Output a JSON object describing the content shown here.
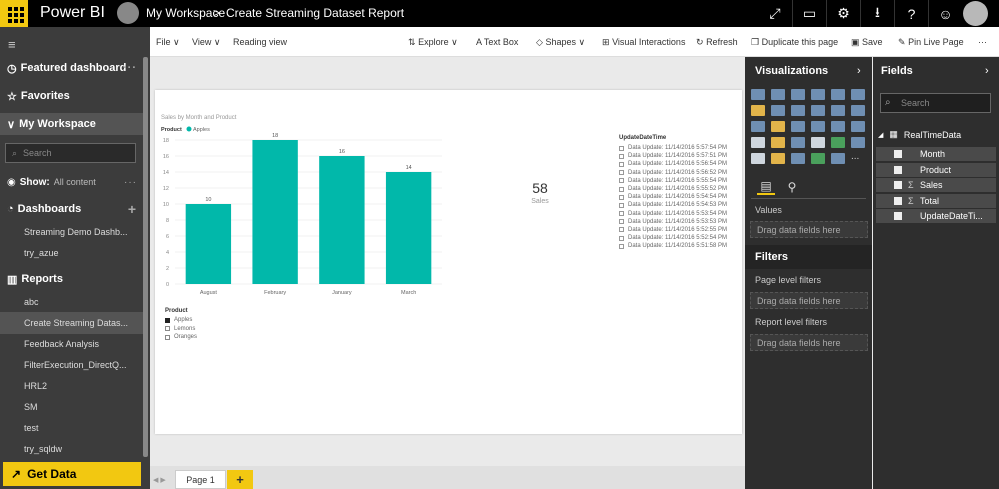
{
  "topbar": {
    "brand": "Power BI",
    "workspace": "My Workspace",
    "separator": ">",
    "report_title": "Create Streaming Dataset Report"
  },
  "sidebar": {
    "featured": "Featured dashboard",
    "favorites": "Favorites",
    "my_workspace": "My Workspace",
    "search_placeholder": "Search",
    "show_label": "Show:",
    "show_value": "All content",
    "dashboards": "Dashboards",
    "dashboard_items": [
      "Streaming Demo Dashb...",
      "try_azue"
    ],
    "reports": "Reports",
    "report_items": [
      "abc",
      "Create Streaming Datas...",
      "Feedback Analysis",
      "FilterExecution_DirectQ...",
      "HRL2",
      "SM",
      "test",
      "try_sqldw"
    ],
    "get_data": "Get Data"
  },
  "toolbar": {
    "file": "File",
    "view": "View",
    "reading_view": "Reading view",
    "explore": "Explore",
    "text_box": "Text Box",
    "shapes": "Shapes",
    "visual_interactions": "Visual Interactions",
    "refresh": "Refresh",
    "duplicate": "Duplicate this page",
    "save": "Save",
    "pin_live": "Pin Live Page"
  },
  "chart_data": {
    "type": "bar",
    "title": "Sales by Month and Product",
    "legend_title": "Product",
    "series": [
      {
        "name": "Apples",
        "values": [
          10,
          18,
          16,
          14
        ],
        "color": "#01b8aa"
      }
    ],
    "categories": [
      "August",
      "February",
      "January",
      "March"
    ],
    "ylim": [
      0,
      18
    ],
    "yticks": [
      0,
      2,
      4,
      6,
      8,
      10,
      12,
      14,
      16,
      18
    ],
    "grid": true
  },
  "card": {
    "value": "58",
    "label": "Sales"
  },
  "slicer": {
    "title": "UpdateDateTime",
    "items": [
      "Data Update: 11/14/2016 5:57:54 PM",
      "Data Update: 11/14/2016 5:57:51 PM",
      "Data Update: 11/14/2016 5:56:54 PM",
      "Data Update: 11/14/2016 5:56:52 PM",
      "Data Update: 11/14/2016 5:55:54 PM",
      "Data Update: 11/14/2016 5:55:52 PM",
      "Data Update: 11/14/2016 5:54:54 PM",
      "Data Update: 11/14/2016 5:54:53 PM",
      "Data Update: 11/14/2016 5:53:54 PM",
      "Data Update: 11/14/2016 5:53:53 PM",
      "Data Update: 11/14/2016 5:52:55 PM",
      "Data Update: 11/14/2016 5:52:54 PM",
      "Data Update: 11/14/2016 5:51:58 PM"
    ]
  },
  "product_legend": {
    "title": "Product",
    "items": [
      "Apples",
      "Lemons",
      "Oranges"
    ]
  },
  "pages": {
    "page1": "Page 1",
    "add": "+"
  },
  "viz": {
    "title": "Visualizations",
    "values_label": "Values",
    "drag_here": "Drag data fields here",
    "filters_title": "Filters",
    "page_level": "Page level filters",
    "report_level": "Report level filters",
    "more": "..."
  },
  "fields": {
    "title": "Fields",
    "search_placeholder": "Search",
    "table": "RealTimeData",
    "items": [
      {
        "name": "Month",
        "sigma": ""
      },
      {
        "name": "Product",
        "sigma": ""
      },
      {
        "name": "Sales",
        "sigma": "Σ"
      },
      {
        "name": "Total",
        "sigma": "Σ"
      },
      {
        "name": "UpdateDateTi...",
        "sigma": ""
      }
    ]
  }
}
